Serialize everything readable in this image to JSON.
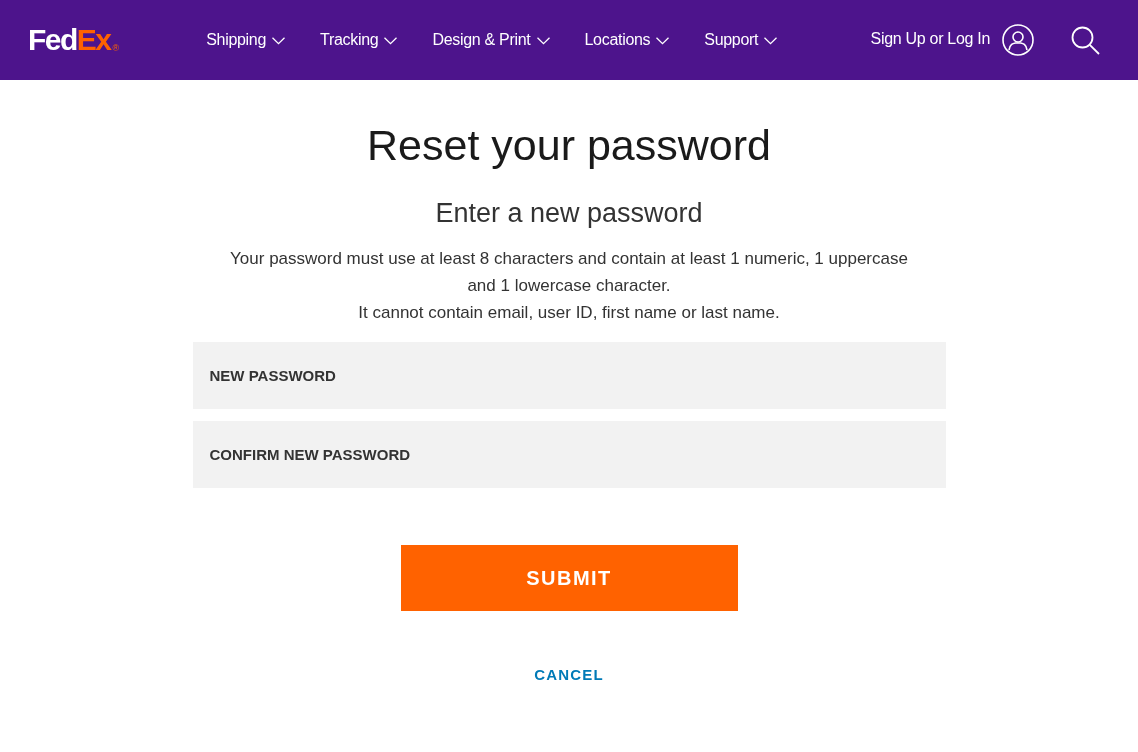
{
  "header": {
    "logo": {
      "part_1": "Fed",
      "part_2": "Ex",
      "mark": "®"
    },
    "nav": [
      {
        "label": "Shipping"
      },
      {
        "label": "Tracking"
      },
      {
        "label": "Design & Print"
      },
      {
        "label": "Locations"
      },
      {
        "label": "Support"
      }
    ],
    "account_link": "Sign Up or Log In"
  },
  "main": {
    "title": "Reset your password",
    "subtitle": "Enter a new password",
    "rules": [
      "Your password must use at least 8 characters and contain at least 1 numeric, 1 uppercase and 1 lowercase character.",
      "It cannot contain email, user ID, first name or last name."
    ],
    "fields": [
      {
        "placeholder": "NEW PASSWORD"
      },
      {
        "placeholder": "CONFIRM NEW PASSWORD"
      }
    ],
    "submit_button": "SUBMIT",
    "cancel_link": "CANCEL"
  }
}
